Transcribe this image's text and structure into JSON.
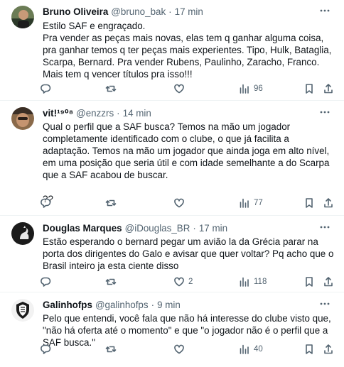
{
  "tweets": [
    {
      "name": "Bruno Oliveira",
      "handle": "@bruno_bak",
      "sep": "·",
      "time": "17 min",
      "text": "Estilo SAF e engraçado.\nPra vender as peças mais novas, elas tem q ganhar alguma coisa, pra ganhar temos q ter peças mais experientes. Tipo, Hulk, Bataglia, Scarpa, Bernard. Pra vender Rubens, Paulinho, Zaracho, Franco. Mais tem q vencer títulos pra isso!!!",
      "replies": "",
      "retweets": "",
      "likes": "",
      "views": "96"
    },
    {
      "name": "vit!¹⁹⁰⁸",
      "handle": "@enzzrs",
      "sep": "·",
      "time": "14 min",
      "text": "Qual o perfil que a SAF busca? Temos na mão um jogador completamente identificado com o clube, o que já facilita a adaptação. Temos na mão um jogador que ainda joga em alto nível, em uma posição que seria útil e com idade semelhante a do Scarpa que a SAF acabou de buscar.\n\n??",
      "replies": "",
      "retweets": "",
      "likes": "",
      "views": "77"
    },
    {
      "name": "Douglas Marques",
      "handle": "@iDouglas_BR",
      "sep": "·",
      "time": "17 min",
      "text": "Estão esperando o bernard pegar um avião la da Grécia parar na porta dos dirigentes do Galo e avisar que quer voltar? Pq acho que o Brasil inteiro ja esta ciente disso",
      "replies": "",
      "retweets": "",
      "likes": "2",
      "views": "118"
    },
    {
      "name": "Galinhofps",
      "handle": "@galinhofps",
      "sep": "·",
      "time": "9 min",
      "text": "Pelo que entendi, você fala que não há interesse do clube visto que, \"não há oferta até o momento\" e que \"o jogador não é o perfil que a SAF busca.\"",
      "replies": "",
      "retweets": "",
      "likes": "",
      "views": "40"
    }
  ],
  "icons": {
    "reply": "reply-icon",
    "retweet": "retweet-icon",
    "like": "heart-icon",
    "views": "views-icon",
    "bookmark": "bookmark-icon",
    "share": "share-icon",
    "more": "more-icon"
  },
  "colors": {
    "text": "#0f1419",
    "secondary": "#536471",
    "divider": "#eff3f4"
  }
}
